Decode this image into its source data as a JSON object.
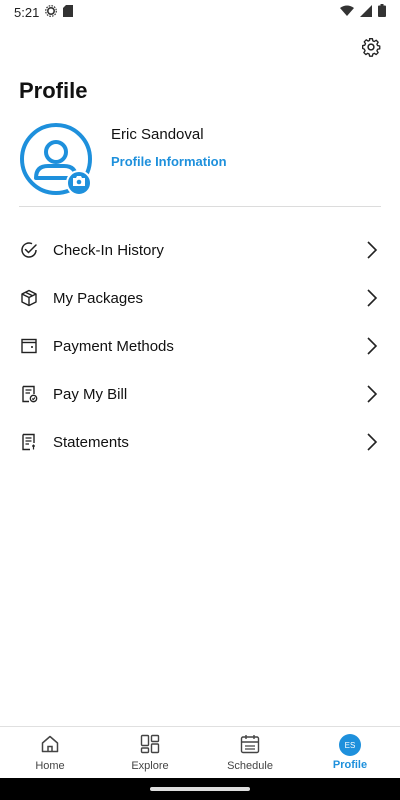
{
  "status_bar": {
    "time": "5:21"
  },
  "header": {
    "title": "Profile"
  },
  "profile": {
    "name": "Eric Sandoval",
    "link_label": "Profile Information",
    "initials": "ES"
  },
  "menu": {
    "items": [
      {
        "label": "Check-In History",
        "icon": "check-circle-icon"
      },
      {
        "label": "My Packages",
        "icon": "package-icon"
      },
      {
        "label": "Payment Methods",
        "icon": "wallet-icon"
      },
      {
        "label": "Pay My Bill",
        "icon": "bill-check-icon"
      },
      {
        "label": "Statements",
        "icon": "statement-icon"
      }
    ]
  },
  "bottom_nav": {
    "items": [
      {
        "label": "Home",
        "icon": "home-icon",
        "active": false
      },
      {
        "label": "Explore",
        "icon": "grid-icon",
        "active": false
      },
      {
        "label": "Schedule",
        "icon": "calendar-icon",
        "active": false
      },
      {
        "label": "Profile",
        "icon": "avatar-icon",
        "active": true
      }
    ]
  },
  "colors": {
    "accent": "#1e90dc",
    "divider": "#dcdcdc"
  }
}
